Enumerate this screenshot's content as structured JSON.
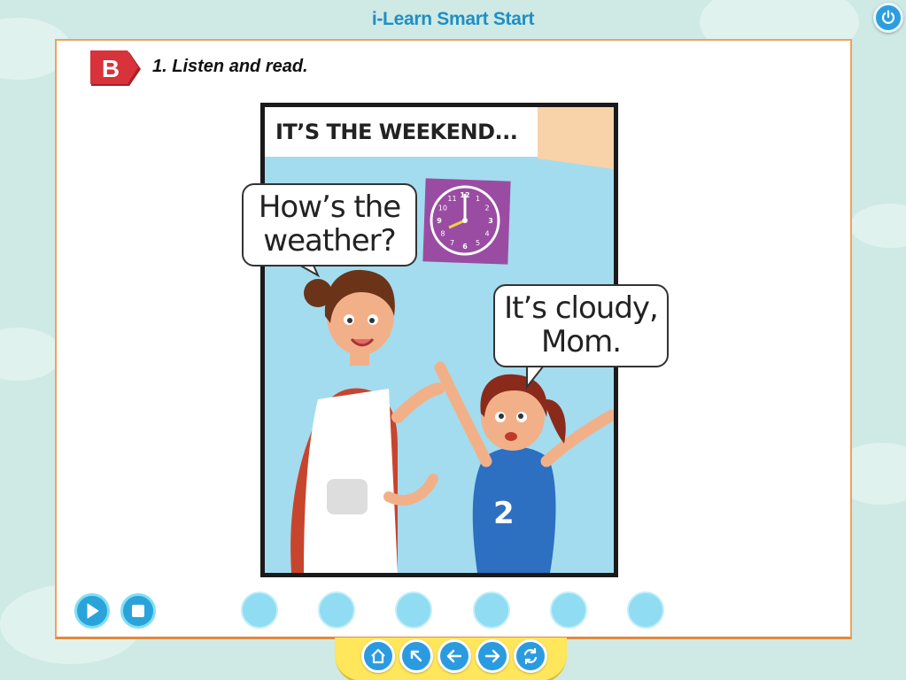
{
  "app": {
    "title": "i-Learn Smart Start"
  },
  "header": {
    "power_icon": "power-icon"
  },
  "section": {
    "badge": "B",
    "instruction": "1. Listen and read."
  },
  "comic": {
    "caption": "IT’S THE WEEKEND...",
    "bubble_mom": "How’s the\nweather?",
    "bubble_girl": "It’s cloudy,\nMom.",
    "shirt_number": "2",
    "clock_numbers": [
      "12",
      "1",
      "2",
      "3",
      "4",
      "5",
      "6",
      "7",
      "8",
      "9",
      "10",
      "11"
    ]
  },
  "controls": {
    "play_icon": "play-icon",
    "stop_icon": "stop-icon",
    "dot_count": 6
  },
  "navigation": {
    "items": [
      "home-icon",
      "back-to-top-icon",
      "previous-icon",
      "next-icon",
      "refresh-icon"
    ]
  },
  "colors": {
    "background": "#cfe9e4",
    "title": "#1f8fc4",
    "page_border": "#f0a25c",
    "badge": "#d8323a",
    "comic_sky": "#a3dcef",
    "nav_bar": "#ffe65a",
    "button_blue": "#2b9be0"
  }
}
